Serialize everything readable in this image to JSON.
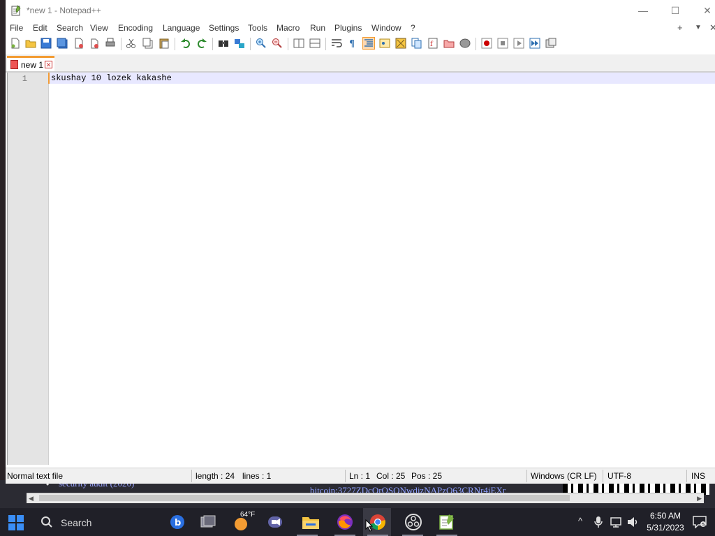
{
  "window": {
    "title": "*new 1 - Notepad++",
    "controls": {
      "minimize": "—",
      "maximize": "☐",
      "close": "✕"
    }
  },
  "menu": {
    "items": [
      "File",
      "Edit",
      "Search",
      "View",
      "Encoding",
      "Language",
      "Settings",
      "Tools",
      "Macro",
      "Run",
      "Plugins",
      "Window",
      "?"
    ],
    "right": [
      "+",
      "▼",
      "✕"
    ]
  },
  "tabs": [
    {
      "label": "new 1",
      "close": "✕"
    }
  ],
  "editor": {
    "line_numbers": [
      "1"
    ],
    "lines": [
      "skushay 10 lozek kakashe"
    ]
  },
  "statusbar": {
    "file_type": "Normal text file",
    "length": "length : 24",
    "lines": "lines : 1",
    "ln": "Ln : 1",
    "col": "Col : 25",
    "pos": "Pos : 25",
    "eol": "Windows (CR LF)",
    "encoding": "UTF-8",
    "mode": "INS"
  },
  "background": {
    "bullet": "•",
    "text1": "security audit (2020)",
    "text2": "bitcoin:3727ZDcQrQSQNwdjzNAPzQ63CRNr4iEXr"
  },
  "taskbar": {
    "search_label": "Search",
    "weather": "64°F",
    "time": "6:50 AM",
    "date": "5/31/2023"
  },
  "colors": {
    "accent_tab": "#f39c33",
    "current_line": "#e8e8ff",
    "taskbar_bg": "#202028"
  }
}
